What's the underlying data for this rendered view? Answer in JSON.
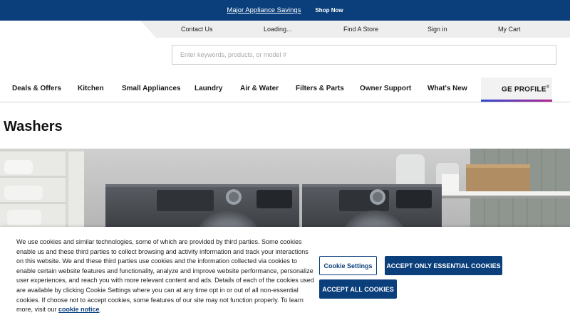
{
  "promo": {
    "text": "Major Appliance Savings",
    "link": "Shop Now",
    "bg_color": "#0a3f7c"
  },
  "utility_nav": {
    "items": [
      "Contact Us",
      "Loading...",
      "Find A Store",
      "Sign in",
      "My Cart"
    ]
  },
  "search": {
    "placeholder": "Enter keywords, products, or model #",
    "value": ""
  },
  "main_nav": {
    "items": [
      "Deals & Offers",
      "Kitchen",
      "Small Appliances",
      "Laundry",
      "Air & Water",
      "Filters & Parts",
      "Owner Support",
      "What's New"
    ],
    "profile_label": "GE PROFILE",
    "profile_mark": "®"
  },
  "page": {
    "title": "Washers"
  },
  "cookie_banner": {
    "text": "We use cookies and similar technologies, some of which are provided by third parties. Some cookies enable us and these third parties to collect browsing and activity information and track your interactions on this website. We and these third parties use cookies and the information collected via cookies to enable certain website features and functionality, analyze and improve website performance, personalize user experiences, and reach you with more relevant content and ads. Details of each of the cookies used are available by clicking Cookie Settings where you can at any time opt in or out of all non-essential cookies. If choose not to accept cookies, some features of our site may not function properly. To learn more, visit our",
    "link_text": "cookie notice",
    "end_text": ".",
    "settings_label": "Cookie Settings",
    "essential_label": "ACCEPT ONLY ESSENTIAL COOKIES",
    "accept_all_label": "ACCEPT ALL COOKIES"
  },
  "colors": {
    "brand_blue": "#0a3f7c",
    "profile_gradient_start": "#2e4bd2",
    "profile_gradient_end": "#b2278f"
  }
}
